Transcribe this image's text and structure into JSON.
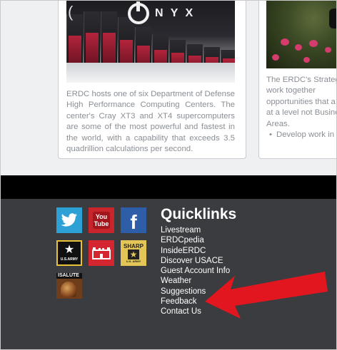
{
  "left_card": {
    "image_text": "N Y X",
    "description": "ERDC hosts one of six Department of Defense High Performance Computing Centers. The center's Cray XT3 and XT4 supercomputers are some of the most powerful and fastest in the world, with a capability that exceeds 3.5 quadrillion calculations per second."
  },
  "right_card": {
    "description": "The ERDC's Strategi to work together opportunities that a and at a level not Business Areas.",
    "bullets": [
      "Develop work in a way"
    ]
  },
  "footer": {
    "quicklinks_title": "Quicklinks",
    "links": [
      "Livestream",
      "ERDCpedia",
      "InsideERDC",
      "Discover USACE",
      "Guest Account Info",
      "Weather",
      "Suggestions",
      "Feedback",
      "Contact Us"
    ],
    "social": {
      "youtube_text": "You Tube",
      "facebook_text": "f",
      "army_text": "U.S.ARMY",
      "sharp_text": "SHARP",
      "sharp_sub": "U.S. ARMY",
      "isalute_text": "ISALUTE"
    }
  },
  "colors": {
    "footer_bg": "#3a3c3f",
    "band": "#000000",
    "twitter": "#2da0d6",
    "youtube": "#c9252c",
    "facebook": "#2e5ea8",
    "arrow": "#e2161f"
  }
}
